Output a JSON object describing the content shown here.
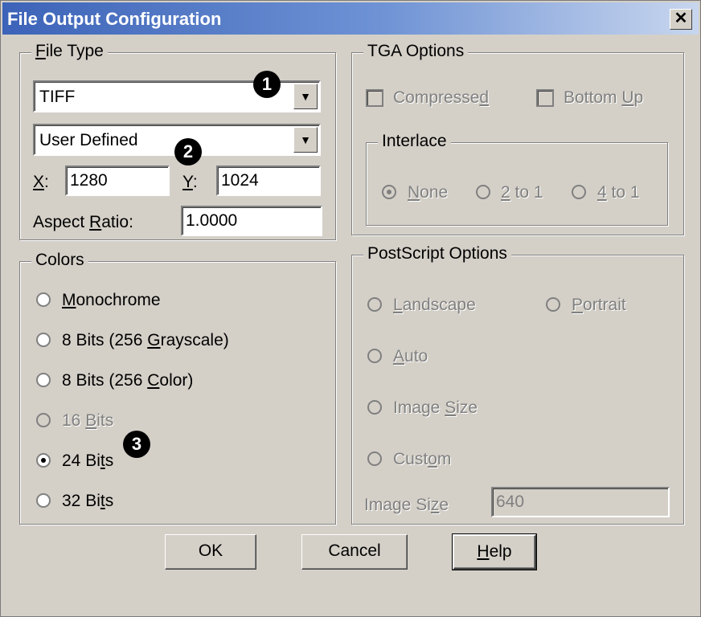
{
  "window": {
    "title": "File Output Configuration",
    "close_glyph": "✕"
  },
  "file_type": {
    "legend_key": "F",
    "legend_rest": "ile Type",
    "format_value": "TIFF",
    "resolution_value": "User Defined",
    "x_label_key": "X",
    "x_label_rest": ":",
    "x_value": "1280",
    "y_label_key": "Y",
    "y_label_rest": ":",
    "y_value": "1024",
    "aspect_label_pre": "Aspect ",
    "aspect_label_key": "R",
    "aspect_label_rest": "atio:",
    "aspect_value": "1.0000"
  },
  "tga": {
    "legend": "TGA Options",
    "compressed_pre": "Compresse",
    "compressed_key": "d",
    "bottomup_pre": "Bottom ",
    "bottomup_key": "U",
    "bottomup_rest": "p",
    "interlace_legend": "Interlace",
    "none_key": "N",
    "none_rest": "one",
    "two_key": "2",
    "two_rest": " to 1",
    "four_key": "4",
    "four_rest": " to 1"
  },
  "colors": {
    "legend": "Colors",
    "mono_key": "M",
    "mono_rest": "onochrome",
    "gray_pre": "8 Bits (256 ",
    "gray_key": "G",
    "gray_rest": "rayscale)",
    "color_pre": "8 Bits (256 ",
    "color_key": "C",
    "color_rest": "olor)",
    "b16_pre": "16 ",
    "b16_key": "B",
    "b16_rest": "its",
    "b24_pre": "24 Bi",
    "b24_key": "t",
    "b24_rest": "s",
    "b32_pre": "32 Bi",
    "b32_key": "t",
    "b32_rest": "s",
    "selected": "24 Bits"
  },
  "postscript": {
    "legend": "PostScript Options",
    "landscape_key": "L",
    "landscape_rest": "andscape",
    "portrait_key": "P",
    "portrait_rest": "ortrait",
    "auto_key": "A",
    "auto_rest": "uto",
    "imgsize_pre": "Image ",
    "imgsize_key": "S",
    "imgsize_rest": "ize",
    "custom_pre": "Cust",
    "custom_key": "o",
    "custom_rest": "m",
    "imgsize_field_pre": "Image Si",
    "imgsize_field_key": "z",
    "imgsize_field_rest": "e",
    "imgsize_value": "640"
  },
  "buttons": {
    "ok": "OK",
    "cancel": "Cancel",
    "help_key": "H",
    "help_rest": "elp"
  },
  "callouts": [
    "1",
    "2",
    "3"
  ],
  "icons": {
    "combo_arrow": "▼"
  }
}
